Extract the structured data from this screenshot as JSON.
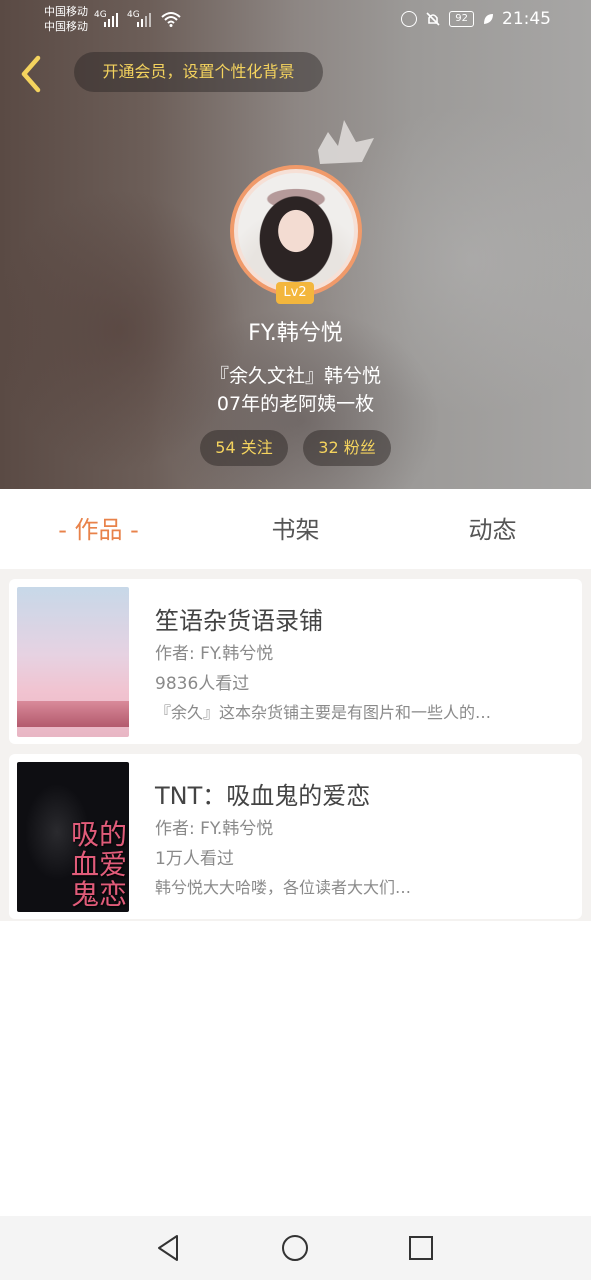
{
  "status_bar": {
    "carrier_1": "中国移动",
    "carrier_2": "中国移动",
    "signal_1": "4G",
    "signal_2": "4G",
    "battery": "92",
    "time": "21:45"
  },
  "header": {
    "member_tip": "开通会员，设置个性化背景",
    "level": "Lv2",
    "username": "FY.韩兮悦",
    "bio_line_1": "『余久文社』韩兮悦",
    "bio_line_2": "07年的老阿姨一枚",
    "follow_label": "54 关注",
    "fans_label": "32 粉丝"
  },
  "tabs": [
    {
      "label": "- 作品 -",
      "active": true
    },
    {
      "label": "书架",
      "active": false
    },
    {
      "label": "动态",
      "active": false
    }
  ],
  "books": [
    {
      "title": "笙语杂货语录铺",
      "author": "作者: FY.韩兮悦",
      "views": "9836人看过",
      "desc": "『余久』这本杂货铺主要是有图片和一些人的…"
    },
    {
      "title": "TNT：吸血鬼的爱恋",
      "author": "作者: FY.韩兮悦",
      "views": "1万人看过",
      "desc": "韩兮悦大大哈喽，各位读者大大们…",
      "cover_text": "吸的血爱鬼恋"
    }
  ],
  "colors": {
    "accent": "#e8824a",
    "gold": "#f4d35e",
    "level_badge": "#f3b63d"
  }
}
